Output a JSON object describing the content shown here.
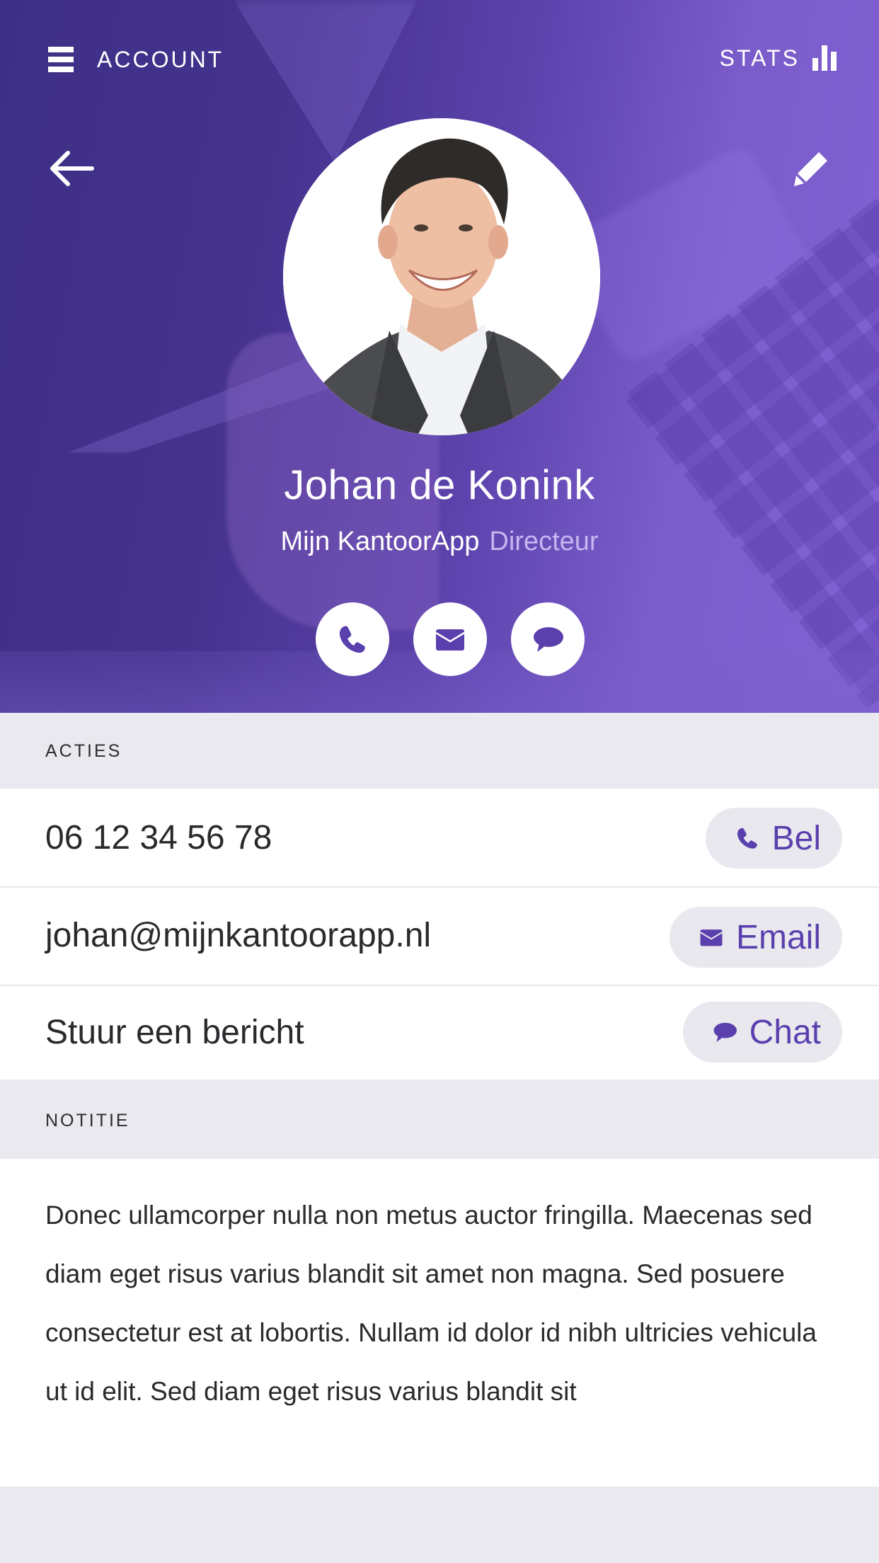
{
  "colors": {
    "accent": "#5a40ad",
    "hero_dark": "#3e2f86",
    "hero_light": "#8262d4",
    "section_bg": "#eae9ef",
    "pill_bg": "#e9e8ef",
    "role_text": "#c5b6f0"
  },
  "topbar": {
    "menu_icon": "hamburger-icon",
    "account_label": "ACCOUNT",
    "stats_label": "STATS",
    "stats_icon": "bar-chart-icon"
  },
  "hero": {
    "back_icon": "arrow-left-icon",
    "edit_icon": "pencil-icon",
    "avatar_alt": "Johan de Konink",
    "name": "Johan de Konink",
    "company": "Mijn KantoorApp",
    "role": "Directeur",
    "quick_actions": [
      {
        "icon": "phone-icon",
        "label": "Bel"
      },
      {
        "icon": "envelope-icon",
        "label": "Email"
      },
      {
        "icon": "chat-bubble-icon",
        "label": "Chat"
      }
    ]
  },
  "actions": {
    "header": "ACTIES",
    "rows": [
      {
        "text": "06 12 34 56 78",
        "button_label": "Bel",
        "button_icon": "phone-icon"
      },
      {
        "text": "johan@mijnkantoorapp.nl",
        "button_label": "Email",
        "button_icon": "envelope-icon"
      },
      {
        "text": "Stuur een bericht",
        "button_label": "Chat",
        "button_icon": "chat-bubble-icon"
      }
    ]
  },
  "notes": {
    "header": "NOTITIE",
    "body": "Donec ullamcorper nulla non metus auctor fringilla. Maecenas sed diam eget risus varius blandit sit amet non magna. Sed posuere consectetur est at lobortis. Nullam id dolor id nibh ultricies vehicula ut id elit. Sed diam eget risus varius blandit sit"
  }
}
